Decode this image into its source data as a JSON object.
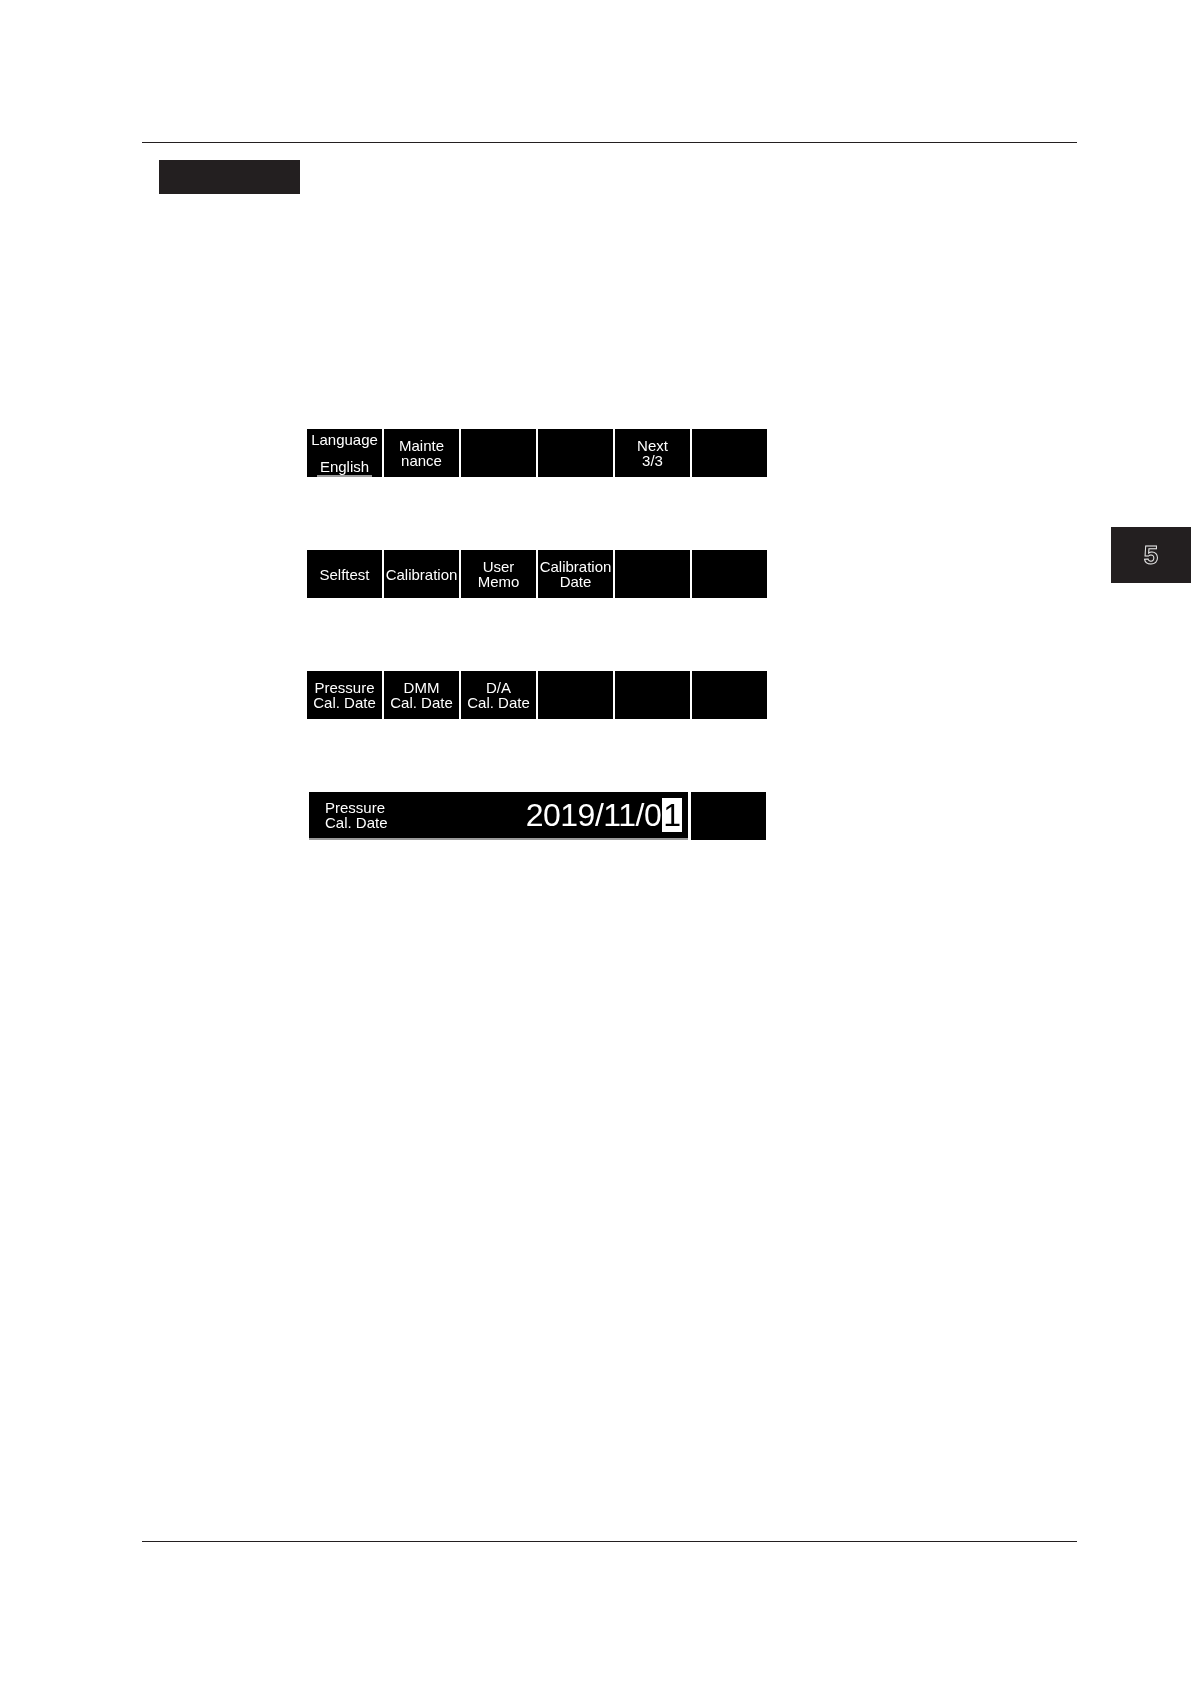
{
  "chapter_tab": {
    "number": "5"
  },
  "softkey_menus": [
    {
      "keys": [
        {
          "kind": "setting",
          "label": "Language",
          "value": "English"
        },
        {
          "kind": "label",
          "lines": [
            "Mainte",
            "nance"
          ]
        },
        {
          "kind": "blank"
        },
        {
          "kind": "blank"
        },
        {
          "kind": "label",
          "lines": [
            "Next",
            "3/3"
          ]
        },
        {
          "kind": "blank"
        }
      ]
    },
    {
      "keys": [
        {
          "kind": "label",
          "lines": [
            "Selftest"
          ]
        },
        {
          "kind": "label",
          "lines": [
            "Calibration"
          ]
        },
        {
          "kind": "label",
          "lines": [
            "User",
            "Memo"
          ]
        },
        {
          "kind": "label",
          "lines": [
            "Calibration",
            "Date"
          ]
        },
        {
          "kind": "blank"
        },
        {
          "kind": "blank"
        }
      ]
    },
    {
      "keys": [
        {
          "kind": "label",
          "lines": [
            "Pressure",
            "Cal. Date"
          ]
        },
        {
          "kind": "label",
          "lines": [
            "DMM",
            "Cal. Date"
          ]
        },
        {
          "kind": "label",
          "lines": [
            "D/A",
            "Cal. Date"
          ]
        },
        {
          "kind": "blank"
        },
        {
          "kind": "blank"
        },
        {
          "kind": "blank"
        }
      ]
    },
    {
      "keys": [
        {
          "kind": "entry",
          "label_lines": [
            "Pressure",
            "Cal. Date"
          ],
          "value": "2019/11/0",
          "cursor_char": "1"
        },
        {
          "kind": "blank"
        }
      ]
    }
  ]
}
